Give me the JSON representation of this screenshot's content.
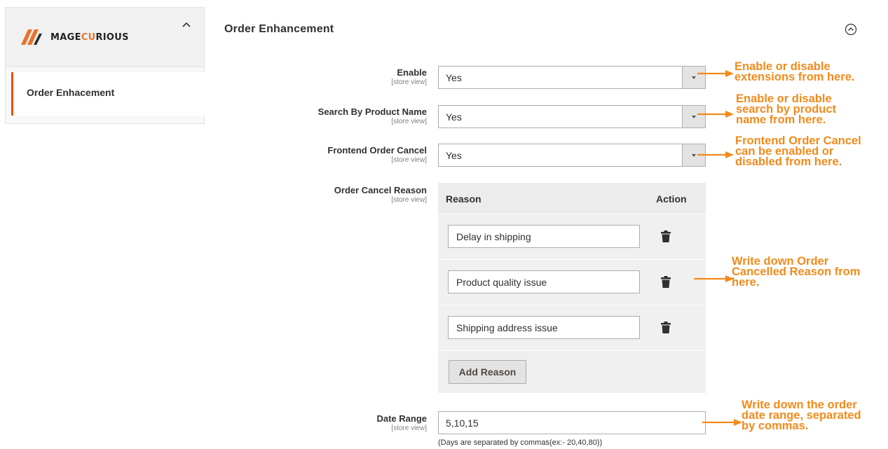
{
  "sidebar": {
    "logo": {
      "prefix": "MAGE",
      "accent": "CU",
      "rest": "RIOUS"
    },
    "toggle_icon": "chevron-up-icon",
    "item_label": "Order Enhacement"
  },
  "section": {
    "title": "Order Enhancement",
    "toggle_icon": "collapse-circle-icon"
  },
  "fields": {
    "enable": {
      "label": "Enable",
      "scope": "[store view]",
      "value": "Yes"
    },
    "search": {
      "label": "Search By Product Name",
      "scope": "[store view]",
      "value": "Yes"
    },
    "cancel": {
      "label": "Frontend Order Cancel",
      "scope": "[store view]",
      "value": "Yes"
    },
    "reason": {
      "label": "Order Cancel Reason",
      "scope": "[store view]"
    },
    "date": {
      "label": "Date Range",
      "scope": "[store view]",
      "value": "5,10,15",
      "note": "(Days are separated by commas(ex:- 20,40,80))"
    }
  },
  "reasons": {
    "headers": {
      "reason": "Reason",
      "action": "Action"
    },
    "rows": [
      "Delay in shipping",
      "Product quality issue",
      "Shipping address issue"
    ],
    "add_label": "Add Reason"
  },
  "annotations": {
    "enable": [
      "Enable or disable",
      "extensions from here."
    ],
    "search": [
      "Enable or disable",
      "search by product",
      "name from here."
    ],
    "cancel": [
      "Frontend Order Cancel",
      "can be enabled or",
      "disabled from here."
    ],
    "reason": [
      "Write down Order",
      "Cancelled Reason from",
      "here."
    ],
    "date": [
      "Write down the order",
      "date range, separated",
      "by commas."
    ]
  },
  "colors": {
    "accent": "#eb5202",
    "annotation": "#f28a1c"
  }
}
